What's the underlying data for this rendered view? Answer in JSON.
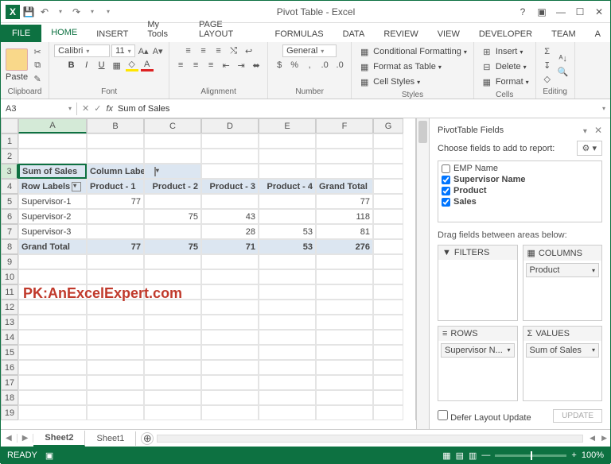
{
  "window": {
    "title": "Pivot Table - Excel"
  },
  "qat": {
    "excel": "X",
    "save": "💾",
    "undo": "↶",
    "redo": "↷"
  },
  "tabs": {
    "file": "FILE",
    "home": "HOME",
    "insert": "INSERT",
    "mytools": "My Tools",
    "pagelayout": "PAGE LAYOUT",
    "formulas": "FORMULAS",
    "data": "DATA",
    "review": "REVIEW",
    "view": "VIEW",
    "developer": "DEVELOPER",
    "team": "TEAM",
    "analyze": "A"
  },
  "ribbon": {
    "clipboard": "Clipboard",
    "paste": "Paste",
    "font": "Font",
    "font_name": "Calibri",
    "font_size": "11",
    "alignment": "Alignment",
    "number": "Number",
    "number_format": "General",
    "styles": "Styles",
    "cond_fmt": "Conditional Formatting",
    "fmt_table": "Format as Table",
    "cell_styles": "Cell Styles",
    "cells": "Cells",
    "insert": "Insert",
    "delete": "Delete",
    "format": "Format",
    "editing": "Editing"
  },
  "namebox": "A3",
  "formula": "Sum of Sales",
  "columns": [
    "A",
    "B",
    "C",
    "D",
    "E",
    "F",
    "G"
  ],
  "rows": [
    "1",
    "2",
    "3",
    "4",
    "5",
    "6",
    "7",
    "8",
    "9",
    "10",
    "11",
    "12",
    "13",
    "14",
    "15",
    "16",
    "17",
    "18",
    "19"
  ],
  "pivot": {
    "a3": "Sum of Sales",
    "b3": "Column Labels",
    "a4": "Row Labels",
    "b4": "Product - 1",
    "c4": "Product - 2",
    "d4": "Product - 3",
    "e4": "Product - 4",
    "f4": "Grand Total",
    "a5": "Supervisor-1",
    "b5": "77",
    "f5": "77",
    "a6": "Supervisor-2",
    "c6": "75",
    "d6": "43",
    "f6": "118",
    "a7": "Supervisor-3",
    "d7": "28",
    "e7": "53",
    "f7": "81",
    "a8": "Grand Total",
    "b8": "77",
    "c8": "75",
    "d8": "71",
    "e8": "53",
    "f8": "276"
  },
  "watermark": "PK:AnExcelExpert.com",
  "panel": {
    "title": "PivotTable Fields",
    "choose": "Choose fields to add to report:",
    "fields": {
      "emp": "EMP Name",
      "sup": "Supervisor Name",
      "prod": "Product",
      "sales": "Sales"
    },
    "drag": "Drag fields between areas below:",
    "filters": "FILTERS",
    "columns": "COLUMNS",
    "rows": "ROWS",
    "values": "VALUES",
    "col_pill": "Product",
    "row_pill": "Supervisor N...",
    "val_pill": "Sum of Sales",
    "defer": "Defer Layout Update",
    "update": "UPDATE"
  },
  "sheets": {
    "s1": "Sheet2",
    "s2": "Sheet1"
  },
  "status": {
    "ready": "READY",
    "zoom": "100%"
  },
  "chart_data": {
    "type": "table",
    "title": "Sum of Sales",
    "categories": [
      "Product - 1",
      "Product - 2",
      "Product - 3",
      "Product - 4"
    ],
    "series": [
      {
        "name": "Supervisor-1",
        "values": [
          77,
          null,
          null,
          null
        ]
      },
      {
        "name": "Supervisor-2",
        "values": [
          null,
          75,
          43,
          null
        ]
      },
      {
        "name": "Supervisor-3",
        "values": [
          null,
          null,
          28,
          53
        ]
      }
    ],
    "row_totals": [
      77,
      118,
      81
    ],
    "col_totals": [
      77,
      75,
      71,
      53
    ],
    "grand_total": 276
  }
}
